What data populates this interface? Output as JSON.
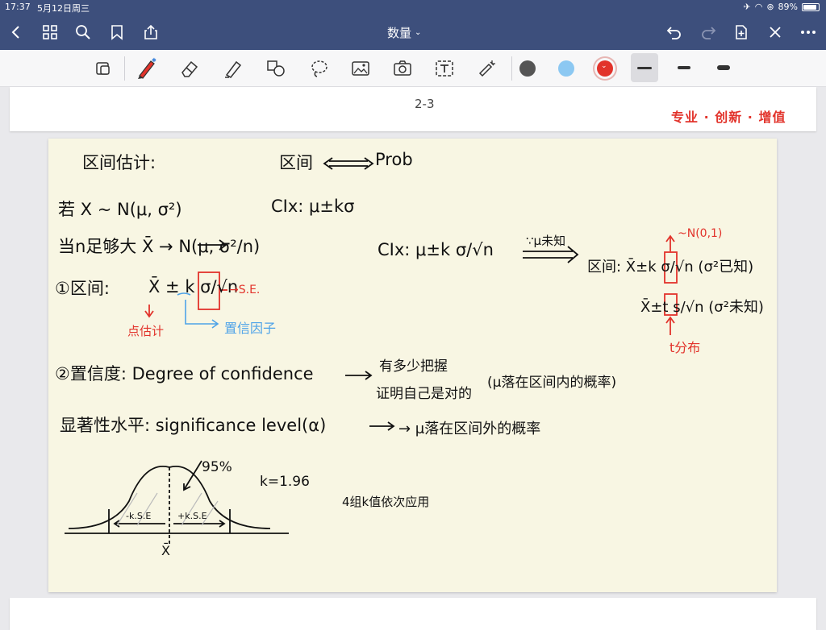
{
  "status": {
    "time": "17:37",
    "date": "5月12日周三",
    "battery": "89%"
  },
  "nav": {
    "title": "数量"
  },
  "header": {
    "page_number": "2-3",
    "slogan": "专业 · 创新 · 增值"
  },
  "notes": {
    "l1_left": "区间估计:",
    "l1_mid": "区间",
    "l1_right": "Prob",
    "l2_left": "若 X ~ N(μ, σ²)",
    "l2_right": "CIx: μ±kσ",
    "l3_left": "当n足够大 X̄ → N(μ, σ²/n)",
    "l3_mid": "CIx: μ±k σ/√n",
    "l3_known": "∵μ未知",
    "l3_ci": "区间: X̄±k σ/√n (σ²已知)",
    "l3_ci2": "X̄±t s/√n (σ²未知)",
    "red_top": "~N(0,1)",
    "red_bottom": "t分布",
    "l4_label": "①区间:",
    "l4_formula": "X̄ ± k σ/√n",
    "se": "→S.E.",
    "point_est": "点估计",
    "conf_factor": "置信因子",
    "l5": "②置信度: Degree of confidence",
    "l5_r1": "有多少把握",
    "l5_r2": "证明自己是对的",
    "l5_r3": "(μ落在区间内的概率)",
    "l6": "显著性水平: significance level(α)",
    "l6_r": "→ μ落在区间外的概率",
    "pct": "95%",
    "k_val": "k=1.96",
    "note4": "4组k值依次应用",
    "kse_left": "-k.S.E",
    "kse_right": "+k.S.E",
    "xbar": "X̄"
  },
  "toolbar": {
    "colors": [
      "#555555",
      "#8cc8f2",
      "#e2332b"
    ]
  }
}
